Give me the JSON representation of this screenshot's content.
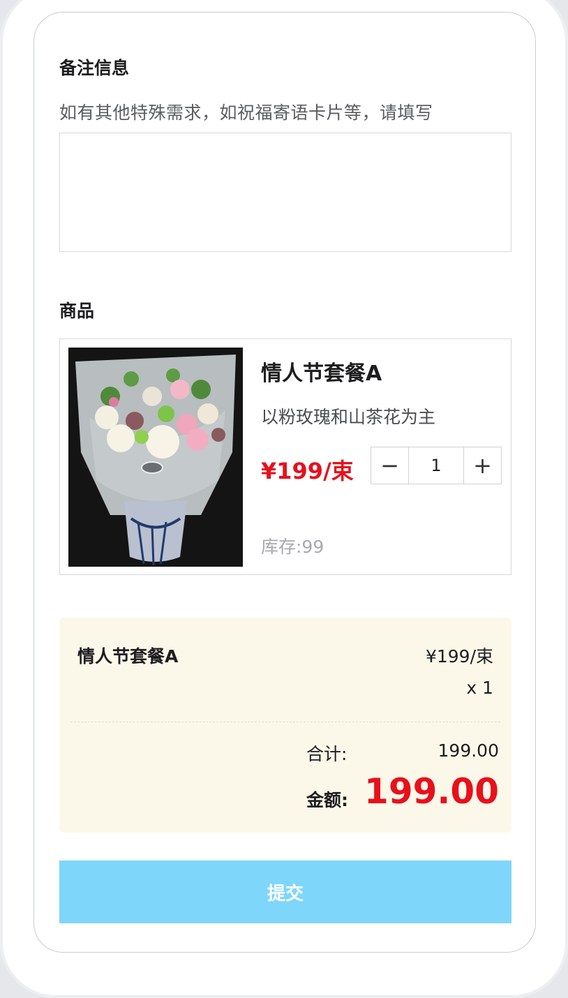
{
  "remark": {
    "title": "备注信息",
    "hint": "如有其他特殊需求，如祝福寄语卡片等，请填写",
    "value": ""
  },
  "goods": {
    "title": "商品",
    "image_icon": "flower-bouquet-photo",
    "name": "情人节套餐A",
    "description": "以粉玫瑰和山茶花为主",
    "price": "¥199/束",
    "quantity": "1",
    "minus_label": "−",
    "plus_label": "+",
    "stock": "库存:99"
  },
  "summary": {
    "item_name": "情人节套餐A",
    "item_price": "¥199/束",
    "item_qty": "x 1",
    "total_label": "合计:",
    "total_value": "199.00",
    "amount_label": "金额:",
    "amount_value": "199.00"
  },
  "submit_label": "提交",
  "colors": {
    "accent_red": "#e8101c",
    "submit_blue": "#7fd6fb",
    "summary_bg": "#fcf8e9"
  }
}
